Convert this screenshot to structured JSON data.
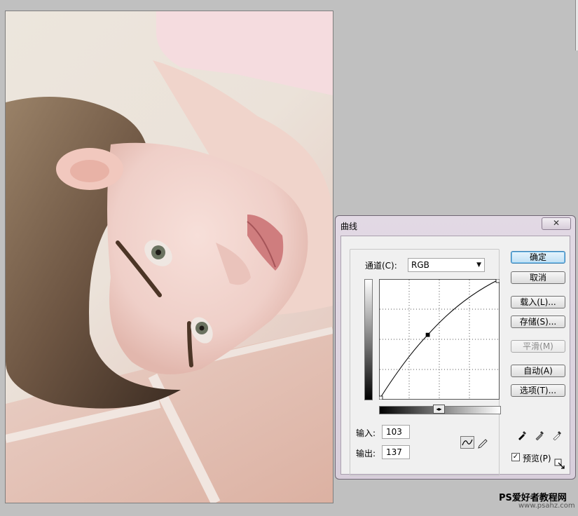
{
  "dialog": {
    "title": "曲线",
    "close_glyph": "✕",
    "channel_label": "通道(C):",
    "channel_value": "RGB",
    "input_label": "输入:",
    "input_value": "103",
    "output_label": "输出:",
    "output_value": "137",
    "buttons": {
      "ok": "确定",
      "cancel": "取消",
      "load": "载入(L)...",
      "save": "存储(S)...",
      "smooth": "平滑(M)",
      "auto": "自动(A)",
      "options": "选项(T)..."
    },
    "preview_label": "预览(P)",
    "preview_checked": true,
    "curve_point": {
      "input": 103,
      "output": 137
    },
    "curve_range": [
      0,
      255
    ]
  },
  "watermark": {
    "text": "PS爱好者教程网",
    "sub": "www.psahz.com"
  },
  "colors": {
    "dialog_bg": "#e2d9e4",
    "default_button": "#bfe0f5",
    "app_bg": "#c0c0c0"
  }
}
